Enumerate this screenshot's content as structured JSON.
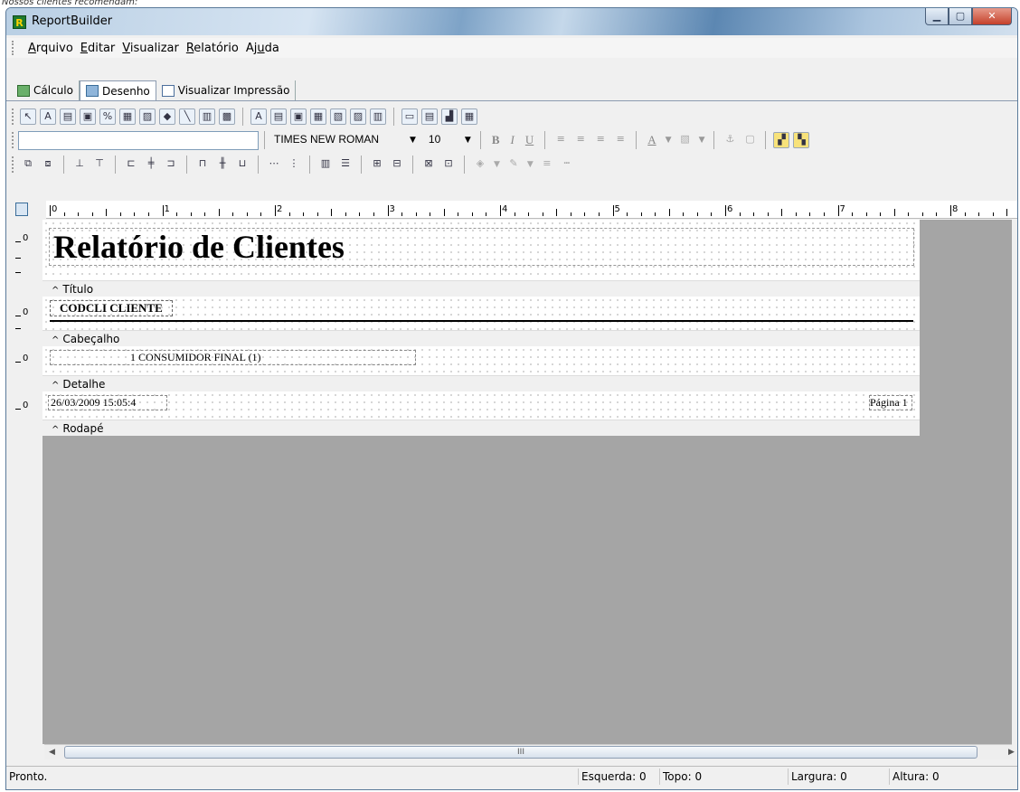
{
  "top_caption": "Nossos clientes recomendam:",
  "window": {
    "title": "ReportBuilder",
    "app_icon": "R"
  },
  "menu": [
    {
      "pre": "",
      "u": "A",
      "post": "rquivo"
    },
    {
      "pre": "",
      "u": "E",
      "post": "ditar"
    },
    {
      "pre": "",
      "u": "V",
      "post": "isualizar"
    },
    {
      "pre": "",
      "u": "R",
      "post": "elatório"
    },
    {
      "pre": "Aj",
      "u": "u",
      "post": "da"
    }
  ],
  "tabs": [
    {
      "label": "Cálculo",
      "icon": "calculator-icon"
    },
    {
      "label": "Desenho",
      "icon": "design-icon"
    },
    {
      "label": "Visualizar Impressão",
      "icon": "print-preview-icon"
    }
  ],
  "format_bar": {
    "font_name": "TIMES NEW ROMAN",
    "font_size": "10",
    "bold": "B",
    "italic": "I",
    "underline": "U",
    "font_color": "A"
  },
  "ruler": {
    "marks": [
      "0",
      "1",
      "2",
      "3",
      "4",
      "5",
      "6",
      "7",
      "8"
    ]
  },
  "report": {
    "title": "Relatório de Clientes",
    "header_fields": "CODCLI CLIENTE",
    "detail_text": "1 CONSUMIDOR FINAL (1)",
    "footer_date": "26/03/2009 15:05:4",
    "footer_page": "Página 1",
    "bands": [
      "Título",
      "Cabeçalho",
      "Detalhe",
      "Rodapé"
    ],
    "band_zero": "0"
  },
  "scrollbar": {
    "thumb_grip": "III"
  },
  "status": {
    "message": "Pronto.",
    "left": "Esquerda: 0",
    "top": "Topo: 0",
    "width": "Largura: 0",
    "height": "Altura: 0"
  }
}
